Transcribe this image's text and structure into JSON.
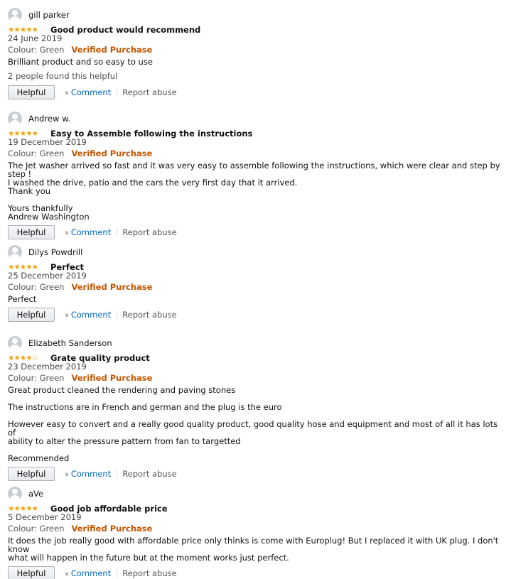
{
  "reviews": [
    {
      "name": "gill parker",
      "stars": "★★★★★",
      "rating": 5,
      "title": "Good product would recommend",
      "date": "24 June 2019",
      "colour": "Colour: Green",
      "verified": "Verified Purchase",
      "body": [
        "Brilliant product and so easy to use"
      ],
      "helpful_count": "2 people found this helpful",
      "helpful_label": "Helpful",
      "comment_label": "Comment",
      "report_label": "Report abuse"
    },
    {
      "name": "Andrew w.",
      "stars": "★★★★★",
      "rating": 5,
      "title": "Easy to Assemble following the instructions",
      "date": "19 December 2019",
      "colour": "Colour: Green",
      "verified": "Verified Purchase",
      "body": [
        "The Jet washer arrived so fast and it was very easy to assemble following the instructions, which were clear and step by step !",
        "I washed the drive, patio and the cars the very first day that it arrived.",
        "Thank you",
        "",
        "Yours thankfully",
        "Andrew Washington"
      ],
      "helpful_label": "Helpful",
      "comment_label": "Comment",
      "report_label": "Report abuse"
    },
    {
      "name": "Dilys Powdrill",
      "stars": "★★★★★",
      "rating": 5,
      "title": "Perfect",
      "date": "25 December 2019",
      "colour": "Colour: Green",
      "verified": "Verified Purchase",
      "body": [
        "Perfect"
      ],
      "helpful_label": "Helpful",
      "comment_label": "Comment",
      "report_label": "Report abuse"
    },
    {
      "name": "Elizabeth Sanderson",
      "stars": "★★★★☆",
      "rating": 4,
      "title": "Grate quality product",
      "date": "23 December 2019",
      "colour": "Colour: Green",
      "verified": "Verified Purchase",
      "body": [
        "Great product cleaned the rendering and paving stones",
        "",
        "The instructions are in French and german and the plug is the euro",
        "",
        "However easy to convert and a really good quality product, good quality hose and equipment and most of all it has lots of",
        "ability to alter the pressure pattern from fan to targetted",
        "",
        "Recommended"
      ],
      "helpful_label": "Helpful",
      "comment_label": "Comment",
      "report_label": "Report abuse"
    },
    {
      "name": "aVe",
      "stars": "★★★★★",
      "rating": 5,
      "title": "Good job affordable price",
      "date": "5 December 2019",
      "colour": "Colour: Green",
      "verified": "Verified Purchase",
      "body": [
        "It does the job really good with affordable price only thinks is come with Europlug! But I replaced it with UK plug. I don't know",
        "what will happen in the future but at the moment works just perfect."
      ],
      "helpful_label": "Helpful",
      "comment_label": "Comment",
      "report_label": "Report abuse"
    }
  ]
}
